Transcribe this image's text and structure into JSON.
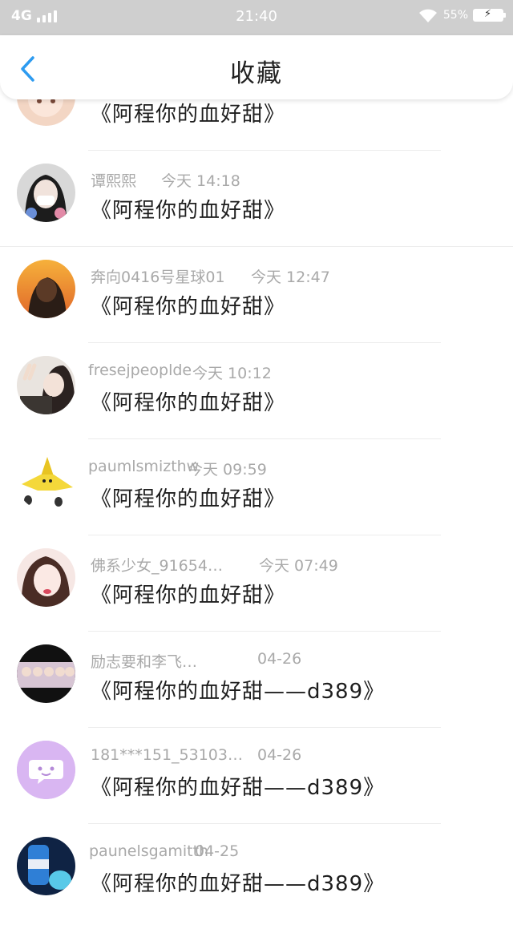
{
  "status_bar": {
    "network": "4G",
    "time": "21:40",
    "battery": "55%"
  },
  "header": {
    "title": "收藏",
    "back_icon": "chevron-left-icon",
    "accent_color": "#2d9bf0"
  },
  "items": [
    {
      "user": "",
      "time": "",
      "content": "《阿程你的血好甜》",
      "avatar": "anime-girl"
    },
    {
      "user": "谭熙熙",
      "time": "今天 14:18",
      "content": "《阿程你的血好甜》",
      "avatar": "girl-mask"
    },
    {
      "user": "奔向0416号星球01",
      "time": "今天 12:47",
      "content": "《阿程你的血好甜》",
      "avatar": "sunset-boy"
    },
    {
      "user": "fresejpeoplde",
      "time": "今天 10:12",
      "content": "《阿程你的血好甜》",
      "avatar": "peace-girl"
    },
    {
      "user": "paumlsmizthw",
      "time": "今天 09:59",
      "content": "《阿程你的血好甜》",
      "avatar": "banana-figure"
    },
    {
      "user": "佛系少女_91654…",
      "time": "今天 07:49",
      "content": "《阿程你的血好甜》",
      "avatar": "pink-girl"
    },
    {
      "user": "励志要和李飞…",
      "time": "04-26",
      "content": "《阿程你的血好甜——d389》",
      "avatar": "group-photo"
    },
    {
      "user": "181***151_53103…",
      "time": "04-26",
      "content": "《阿程你的血好甜——d389》",
      "avatar": "chat-bubble-icon"
    },
    {
      "user": "paunelsgamitth",
      "time": "04-25",
      "content": "《阿程你的血好甜——d389》",
      "avatar": "blue-bottle"
    }
  ]
}
